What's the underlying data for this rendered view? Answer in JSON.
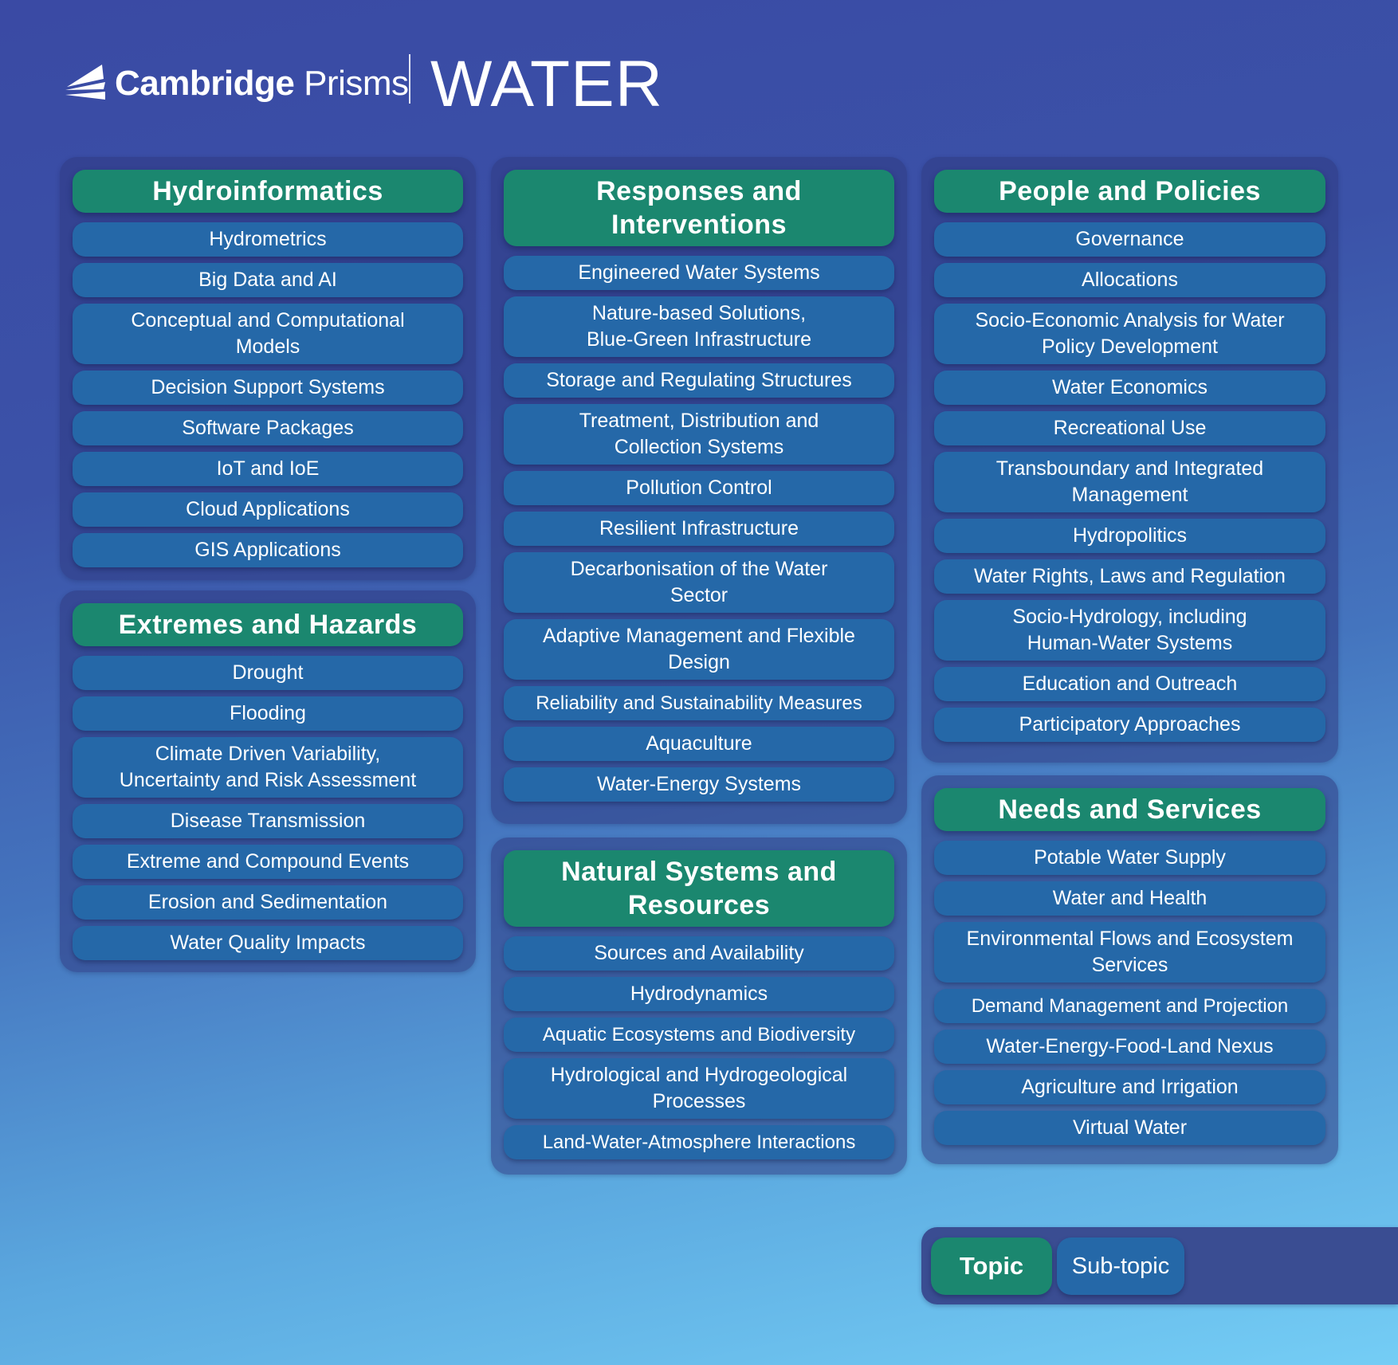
{
  "header": {
    "brand_first": "Cambridge",
    "brand_second": "Prisms",
    "title": "WATER"
  },
  "colors": {
    "topic": "#1b876f",
    "subtopic": "#2568a8",
    "panel": "#303a82",
    "background_top": "#3a4aa4",
    "background_bottom": "#74cdf5"
  },
  "sections": {
    "hydroinformatics": {
      "topic": "Hydroinformatics",
      "subtopics": [
        "Hydrometrics",
        "Big Data and AI",
        "Conceptual and Computational Models",
        "Decision Support Systems",
        "Software Packages",
        "IoT and IoE",
        "Cloud Applications",
        "GIS Applications"
      ]
    },
    "extremes": {
      "topic": "Extremes and Hazards",
      "subtopics": [
        "Drought",
        "Flooding",
        "Climate Driven Variability, Uncertainty and Risk Assessment",
        "Disease Transmission",
        "Extreme and Compound Events",
        "Erosion and Sedimentation",
        "Water Quality Impacts"
      ]
    },
    "responses": {
      "topic": "Responses and Interventions",
      "subtopics": [
        "Engineered Water Systems",
        "Nature-based Solutions, Blue-Green Infrastructure",
        "Storage and Regulating Structures",
        "Treatment, Distribution and Collection Systems",
        "Pollution Control",
        "Resilient Infrastructure",
        "Decarbonisation of the Water Sector",
        "Adaptive Management and Flexible Design",
        "Reliability and Sustainability Measures",
        "Aquaculture",
        "Water-Energy Systems"
      ]
    },
    "natural": {
      "topic": "Natural Systems and Resources",
      "subtopics": [
        "Sources and Availability",
        "Hydrodynamics",
        "Aquatic Ecosystems and Biodiversity",
        "Hydrological and Hydrogeological Processes",
        "Land-Water-Atmosphere Interactions"
      ]
    },
    "people": {
      "topic": "People and Policies",
      "subtopics": [
        "Governance",
        "Allocations",
        "Socio-Economic Analysis for Water Policy Development",
        "Water Economics",
        "Recreational Use",
        "Transboundary and Integrated Management",
        "Hydropolitics",
        "Water Rights, Laws and Regulation",
        "Socio-Hydrology, including Human-Water Systems",
        "Education and Outreach",
        "Participatory Approaches"
      ]
    },
    "needs": {
      "topic": "Needs and Services",
      "subtopics": [
        "Potable Water Supply",
        "Water and Health",
        "Environmental Flows and Ecosystem Services",
        "Demand Management and Projection",
        "Water-Energy-Food-Land Nexus",
        "Agriculture and Irrigation",
        "Virtual Water"
      ]
    }
  },
  "legend": {
    "topic_label": "Topic",
    "subtopic_label": "Sub-topic"
  }
}
